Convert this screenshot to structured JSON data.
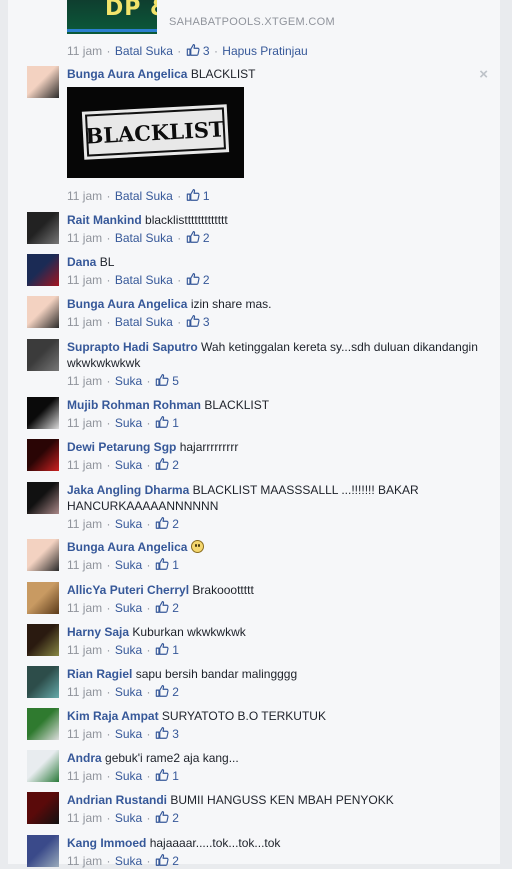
{
  "top_post": {
    "thumb_text": "DP &",
    "domain": "SAHABATPOOLS.XTGEM.COM",
    "time": "11 jam",
    "unlike": "Batal Suka",
    "likes": "3",
    "remove_preview": "Hapus Pratinjau"
  },
  "close_symbol": "×",
  "image_text": "BLACKLIST",
  "comments": [
    {
      "name": "Bunga Aura Angelica",
      "text": "BLACKLIST",
      "time": "11 jam",
      "action": "Batal Suka",
      "likes": "1"
    },
    {
      "name": "Rait Mankind",
      "text": "blacklisttttttttttttt",
      "time": "11 jam",
      "action": "Batal Suka",
      "likes": "2"
    },
    {
      "name": "Dana",
      "text": "BL",
      "time": "11 jam",
      "action": "Batal Suka",
      "likes": "2"
    },
    {
      "name": "Bunga Aura Angelica",
      "text": "izin share mas.",
      "time": "11 jam",
      "action": "Batal Suka",
      "likes": "3"
    },
    {
      "name": "Suprapto Hadi Saputro",
      "text": "Wah ketinggalan kereta sy...sdh duluan dikandangin wkwkwkwkwk",
      "time": "11 jam",
      "action": "Suka",
      "likes": "5"
    },
    {
      "name": "Mujib Rohman Rohman",
      "text": "BLACKLIST",
      "time": "11 jam",
      "action": "Suka",
      "likes": "1"
    },
    {
      "name": "Dewi Petarung Sgp",
      "text": "hajarrrrrrrrr",
      "time": "11 jam",
      "action": "Suka",
      "likes": "2"
    },
    {
      "name": "Jaka Angling Dharma",
      "text": "BLACKLIST MAASSSALLL ...!!!!!!! BAKAR HANCURKAAAAANNNNNN",
      "time": "11 jam",
      "action": "Suka",
      "likes": "2"
    },
    {
      "name": "Bunga Aura Angelica",
      "text": "",
      "time": "11 jam",
      "action": "Suka",
      "likes": "1"
    },
    {
      "name": "AllicYa Puteri Cherryl",
      "text": "Brakooottttt",
      "time": "11 jam",
      "action": "Suka",
      "likes": "2"
    },
    {
      "name": "Harny Saja",
      "text": "Kuburkan wkwkwkwk",
      "time": "11 jam",
      "action": "Suka",
      "likes": "1"
    },
    {
      "name": "Rian Ragiel",
      "text": "sapu bersih bandar malingggg",
      "time": "11 jam",
      "action": "Suka",
      "likes": "2"
    },
    {
      "name": "Kim Raja Ampat",
      "text": "SURYATOTO B.O TERKUTUK",
      "time": "11 jam",
      "action": "Suka",
      "likes": "3"
    },
    {
      "name": "Andra",
      "text": "gebuk'i rame2 aja kang...",
      "time": "11 jam",
      "action": "Suka",
      "likes": "1"
    },
    {
      "name": "Andrian Rustandi",
      "text": "BUMII HANGUSS KEN MBAH PENYOKK",
      "time": "11 jam",
      "action": "Suka",
      "likes": "2"
    },
    {
      "name": "Kang Immoed",
      "text": "hajaaaar.....tok...tok...tok",
      "time": "11 jam",
      "action": "Suka",
      "likes": "2"
    }
  ],
  "colors": {
    "link": "#365899",
    "meta": "#90949c",
    "panel": "#f6f7f9",
    "page": "#e9ebee"
  }
}
